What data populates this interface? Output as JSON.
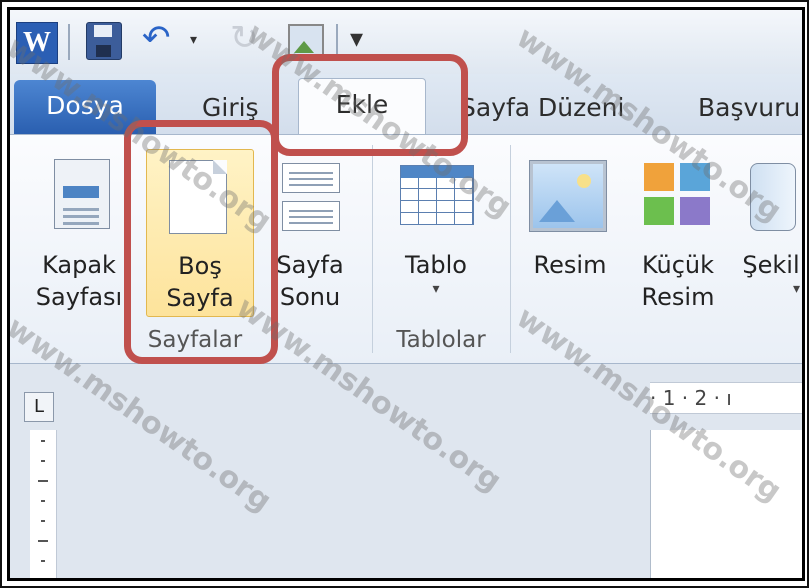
{
  "app": {
    "icon_letter": "W"
  },
  "tabs": [
    {
      "label": "Dosya"
    },
    {
      "label": "Giriş"
    },
    {
      "label": "Ekle"
    },
    {
      "label": "Sayfa Düzeni"
    },
    {
      "label": "Başvuru"
    }
  ],
  "ribbon": {
    "pages_group": {
      "label": "Sayfalar",
      "cover_page": {
        "line1": "Kapak",
        "line2": "Sayfası"
      },
      "blank_page": {
        "line1": "Boş",
        "line2": "Sayfa"
      },
      "page_break": {
        "line1": "Sayfa",
        "line2": "Sonu"
      }
    },
    "tables_group": {
      "label": "Tablolar",
      "table": {
        "line1": "Tablo",
        "caret": "▾"
      }
    },
    "illustrations": {
      "picture": {
        "line1": "Resim"
      },
      "clip_art": {
        "line1": "Küçük",
        "line2": "Resim"
      },
      "shapes": {
        "line1": "Şekil",
        "caret": "▾"
      }
    }
  },
  "ruler": {
    "corner": "L",
    "h_text": "· 1 · 2 · ı"
  },
  "watermark": {
    "text": "www.mshowto.org"
  },
  "colors": {
    "highlight": "#c0504d",
    "file_tab": "#2a5fb0",
    "hover": "#fde39b"
  }
}
